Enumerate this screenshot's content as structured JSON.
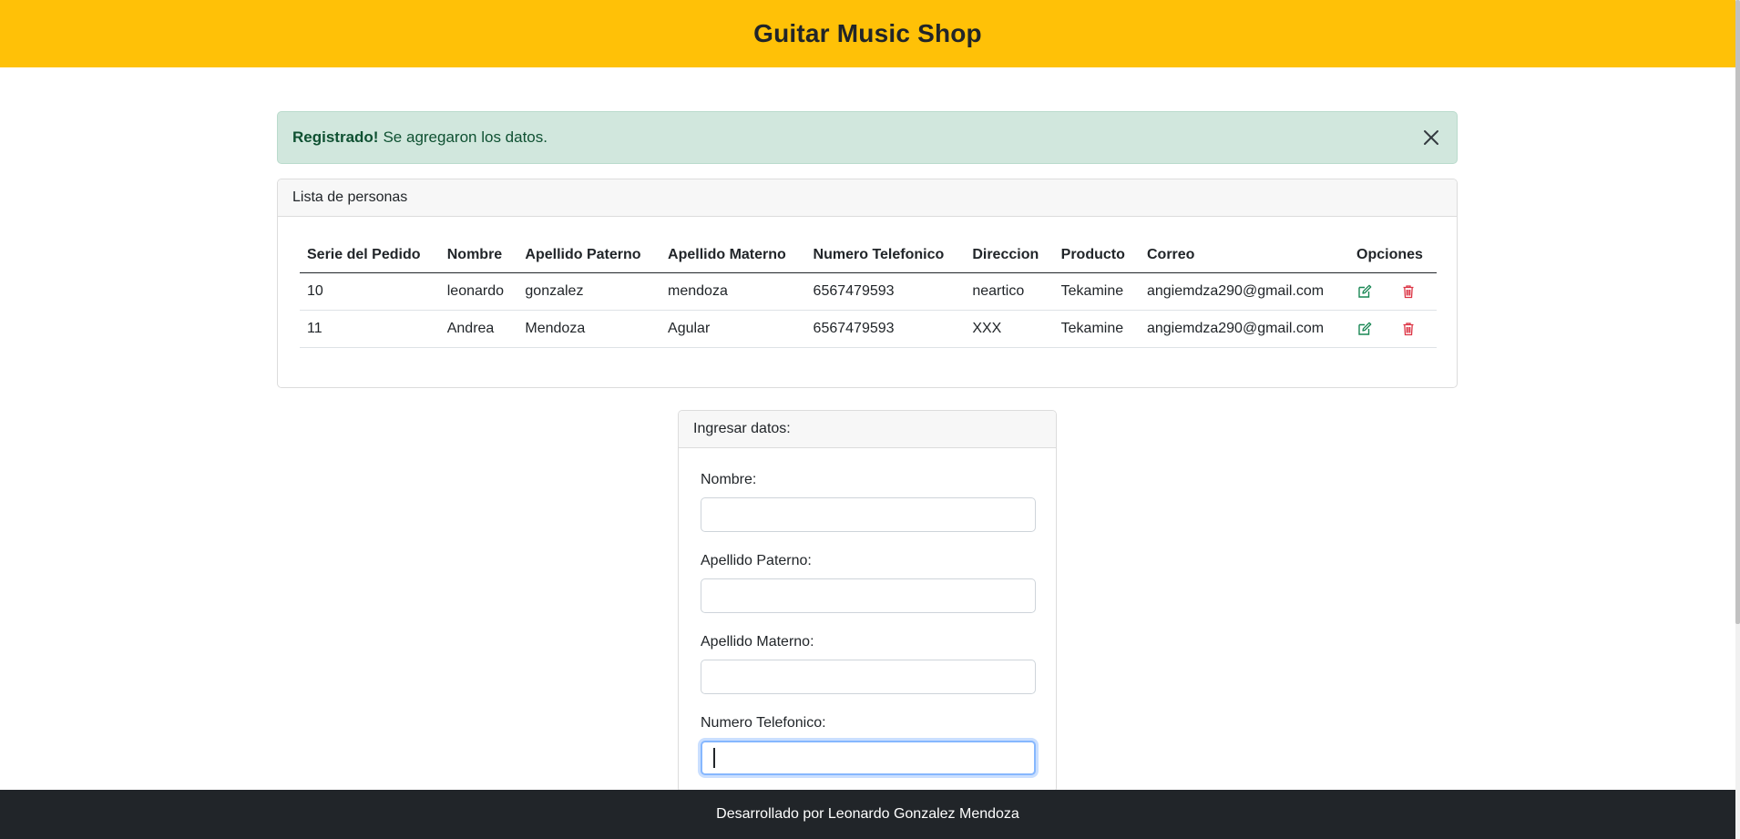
{
  "header": {
    "title": "Guitar Music Shop"
  },
  "alert": {
    "strong": "Registrado!",
    "message": "Se agregaron los datos."
  },
  "list": {
    "title": "Lista de personas",
    "columns": [
      "Serie del Pedido",
      "Nombre",
      "Apellido Paterno",
      "Apellido Materno",
      "Numero Telefonico",
      "Direccion",
      "Producto",
      "Correo",
      "Opciones"
    ],
    "rows": [
      {
        "serie": "10",
        "nombre": "leonardo",
        "paterno": "gonzalez",
        "materno": "mendoza",
        "telefono": "6567479593",
        "direccion": "neartico",
        "producto": "Tekamine",
        "correo": "angiemdza290@gmail.com"
      },
      {
        "serie": "11",
        "nombre": "Andrea",
        "paterno": "Mendoza",
        "materno": "Agular",
        "telefono": "6567479593",
        "direccion": "XXX",
        "producto": "Tekamine",
        "correo": "angiemdza290@gmail.com"
      }
    ],
    "icons": {
      "edit": "edit-icon",
      "delete": "trash-icon"
    }
  },
  "form": {
    "title": "Ingresar datos:",
    "fields": [
      {
        "label": "Nombre:",
        "value": ""
      },
      {
        "label": "Apellido Paterno:",
        "value": ""
      },
      {
        "label": "Apellido Materno:",
        "value": ""
      },
      {
        "label": "Numero Telefonico:",
        "value": ""
      }
    ]
  },
  "footer": {
    "text": "Desarrollado por Leonardo Gonzalez Mendoza"
  },
  "colors": {
    "header": "#ffc107",
    "alert_bg": "#d1e7dd",
    "alert_text": "#0f5132",
    "footer": "#212529",
    "edit": "#198754",
    "delete": "#dc3545",
    "focus": "#86b7fe"
  }
}
